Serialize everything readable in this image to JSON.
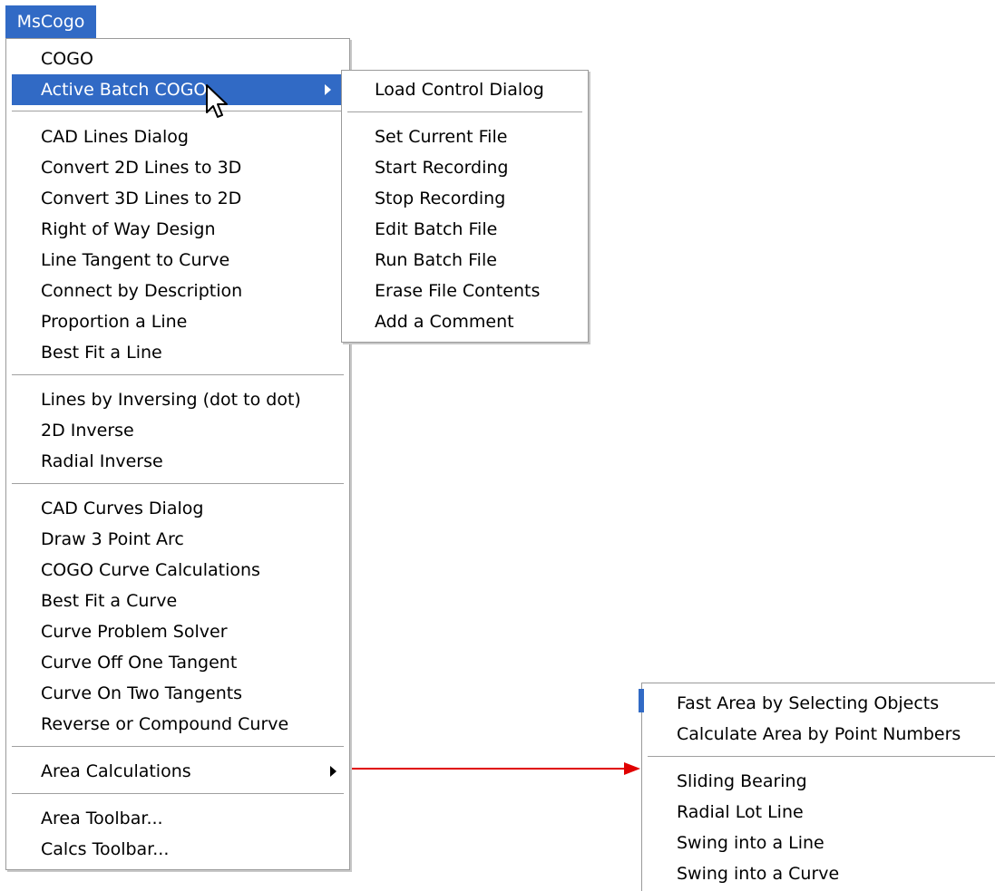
{
  "menubar": {
    "title": "MsCogo"
  },
  "main_menu": {
    "items": [
      "COGO",
      "Active Batch COGO",
      "CAD Lines Dialog",
      "Convert 2D Lines to 3D",
      "Convert 3D Lines to 2D",
      "Right of Way Design",
      "Line Tangent to Curve",
      "Connect by Description",
      "Proportion a Line",
      "Best Fit a Line",
      "Lines by Inversing (dot to dot)",
      "2D Inverse",
      "Radial Inverse",
      "CAD Curves Dialog",
      "Draw 3 Point Arc",
      "COGO Curve Calculations",
      "Best Fit a Curve",
      "Curve Problem Solver",
      "Curve Off One Tangent",
      "Curve On Two Tangents",
      "Reverse or Compound Curve",
      "Area Calculations",
      "Area Toolbar...",
      "Calcs Toolbar..."
    ]
  },
  "batch_submenu": {
    "items": [
      "Load Control Dialog",
      "Set Current File",
      "Start Recording",
      "Stop Recording",
      "Edit Batch File",
      "Run Batch File",
      "Erase File Contents",
      "Add a Comment"
    ]
  },
  "area_submenu": {
    "items": [
      "Fast Area by Selecting Objects",
      "Calculate Area by Point Numbers",
      "Sliding Bearing",
      "Radial Lot Line",
      "Swing into a Line",
      "Swing into a Curve"
    ]
  },
  "colors": {
    "highlight": "#316ac5",
    "callout_arrow": "#e00000"
  },
  "icons": {
    "cursor": "arrow-pointer-icon",
    "submenu": "submenu-arrow-icon"
  }
}
